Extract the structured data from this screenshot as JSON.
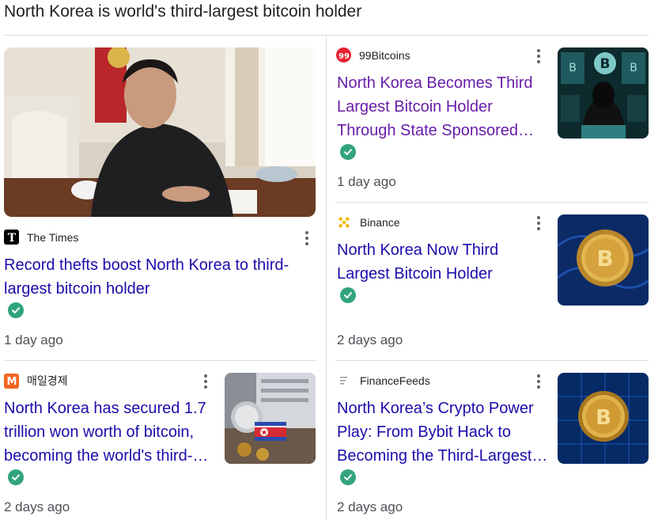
{
  "heading": "North Korea is world's third-largest bitcoin holder",
  "stories": [
    {
      "source": "The Times",
      "logo": "times-t-logo",
      "title": "Record thefts boost North Korea to third-largest bitcoin holder",
      "title_lines": [
        "Record thefts boost North Korea to third-",
        "largest bitcoin holder"
      ],
      "age": "1 day ago"
    },
    {
      "source": "99Bitcoins",
      "logo": "99bitcoins-logo",
      "title": "North Korea Becomes Third Largest Bitcoin Holder Through State Sponsored...",
      "title_lines": [
        "North Korea Becomes Third",
        "Largest Bitcoin Holder",
        "Through State Sponsored…"
      ],
      "age": "1 day ago",
      "visited": true
    },
    {
      "source": "Binance",
      "logo": "binance-logo",
      "title": "North Korea Now Third Largest Bitcoin Holder",
      "title_lines": [
        "North Korea Now Third",
        "Largest Bitcoin Holder"
      ],
      "age": "2 days ago"
    },
    {
      "source": "매일경제",
      "logo": "maeil-m-logo",
      "title": "North Korea has secured 1.7 trillion won worth of bitcoin, becoming the world's third-...",
      "title_lines": [
        "North Korea has secured 1.7",
        "trillion won worth of bitcoin,",
        "becoming the world's third-…"
      ],
      "age": "2 days ago"
    },
    {
      "source": "FinanceFeeds",
      "logo": "financefeeds-logo",
      "title": "North Korea's Crypto Power Play: From Bybit Hack to Becoming the Third-Largest...",
      "title_lines": [
        "North Korea’s Crypto Power",
        "Play: From Bybit Hack to",
        "Becoming the Third-Largest…"
      ],
      "age": "2 days ago"
    }
  ],
  "colors": {
    "title_link": "#1a0dab",
    "title_visited": "#681da8",
    "verified_check": "#31a47f",
    "divider": "#dadce0"
  },
  "icons": {
    "more": "more-vert-icon",
    "verified": "verified-check-icon"
  }
}
